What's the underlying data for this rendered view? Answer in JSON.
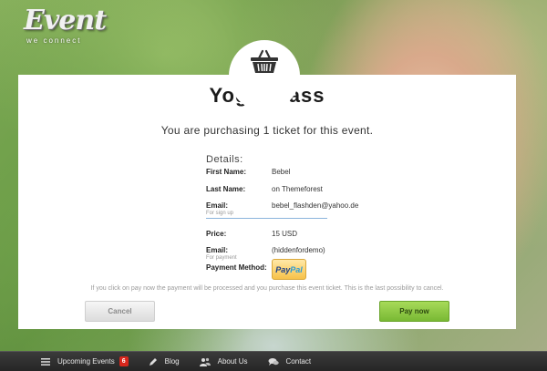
{
  "logo": {
    "text": "Event",
    "tagline": "we connect"
  },
  "event": {
    "title": "Yoga Class",
    "purchase_message": "You are purchasing 1 ticket for this event."
  },
  "details": {
    "heading": "Details:",
    "first_name_label": "First Name:",
    "first_name_value": "Bebel",
    "last_name_label": "Last Name:",
    "last_name_value": "on Themeforest",
    "email_label": "Email:",
    "email_sub": "For sign up",
    "email_value": "bebel_flashden@yahoo.de",
    "price_label": "Price:",
    "price_value": "15 USD",
    "payment_email_label": "Email:",
    "payment_email_sub": "For payment",
    "payment_email_value": "(hiddenfordemo)",
    "payment_method_label": "Payment Method:",
    "paypal_pay": "Pay",
    "paypal_pal": "Pal"
  },
  "notice": "If you click on pay now the payment will be processed and you purchase this event ticket. This is the last possibility to cancel.",
  "buttons": {
    "cancel": "Cancel",
    "pay_now": "Pay now"
  },
  "nav": {
    "items": [
      {
        "label": "Upcoming Events",
        "icon": "list-icon",
        "badge": "6"
      },
      {
        "label": "Blog",
        "icon": "pencil-icon"
      },
      {
        "label": "About Us",
        "icon": "users-icon"
      },
      {
        "label": "Contact",
        "icon": "chat-bubbles-icon"
      }
    ]
  },
  "colors": {
    "pay_button": "#86c33f",
    "badge": "#d8261c",
    "footer": "#2e2e2e"
  }
}
